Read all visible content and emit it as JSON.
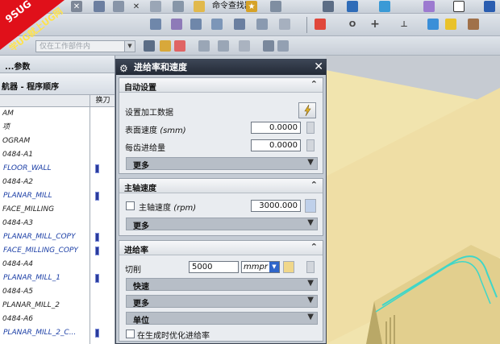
{
  "toolbar": {
    "command_finder": "命令查找器",
    "filter_placeholder": "仅在工作部件内"
  },
  "logo": {
    "line1": "9SUG",
    "line2": "学UG就上UG网"
  },
  "navigator": {
    "panel_title": "...参数",
    "title": "航器 - 程序顺序",
    "col_tool": "换刀",
    "rows": [
      {
        "label": "AM",
        "type": "grp",
        "tool": false
      },
      {
        "label": "项",
        "type": "grp",
        "tool": false
      },
      {
        "label": "OGRAM",
        "type": "grp",
        "tool": false
      },
      {
        "label": "0484-A1",
        "type": "grp",
        "tool": false
      },
      {
        "label": "FLOOR_WALL",
        "type": "op",
        "tool": true
      },
      {
        "label": "0484-A2",
        "type": "grp",
        "tool": false
      },
      {
        "label": "PLANAR_MILL",
        "type": "op",
        "tool": true
      },
      {
        "label": "FACE_MILLING",
        "type": "grp",
        "tool": false
      },
      {
        "label": "0484-A3",
        "type": "grp",
        "tool": false
      },
      {
        "label": "PLANAR_MILL_COPY",
        "type": "op",
        "tool": true
      },
      {
        "label": "FACE_MILLING_COPY",
        "type": "op",
        "tool": true
      },
      {
        "label": "0484-A4",
        "type": "grp",
        "tool": false
      },
      {
        "label": "PLANAR_MILL_1",
        "type": "op",
        "tool": true
      },
      {
        "label": "0484-A5",
        "type": "grp",
        "tool": false
      },
      {
        "label": "PLANAR_MILL_2",
        "type": "grp",
        "tool": false
      },
      {
        "label": "0484-A6",
        "type": "grp",
        "tool": false
      },
      {
        "label": "PLANAR_MILL_2_C...",
        "type": "op",
        "tool": true
      }
    ]
  },
  "dialog": {
    "title": "进给率和速度",
    "auto": {
      "header": "自动设置",
      "set_data_label": "设置加工数据",
      "surface_speed_label": "表面速度",
      "surface_speed_unit": "(smm)",
      "surface_speed_value": "0.0000",
      "feed_per_tooth_label": "每齿进给量",
      "feed_per_tooth_value": "0.0000",
      "more": "更多"
    },
    "spindle": {
      "header": "主轴速度",
      "speed_label": "主轴速度",
      "speed_unit": "(rpm)",
      "speed_value": "3000.000",
      "more": "更多"
    },
    "feed": {
      "header": "进给率",
      "cut_label": "切削",
      "cut_value": "5000",
      "cut_unit": "mmpr",
      "rapid": "快速",
      "more": "更多",
      "units": "单位",
      "optimize_label": "在生成时优化进给率"
    }
  },
  "colors": {
    "part_face": "#f3e6b2",
    "toolpath": "#3fd6c8",
    "title_bar": "#2b3240"
  }
}
